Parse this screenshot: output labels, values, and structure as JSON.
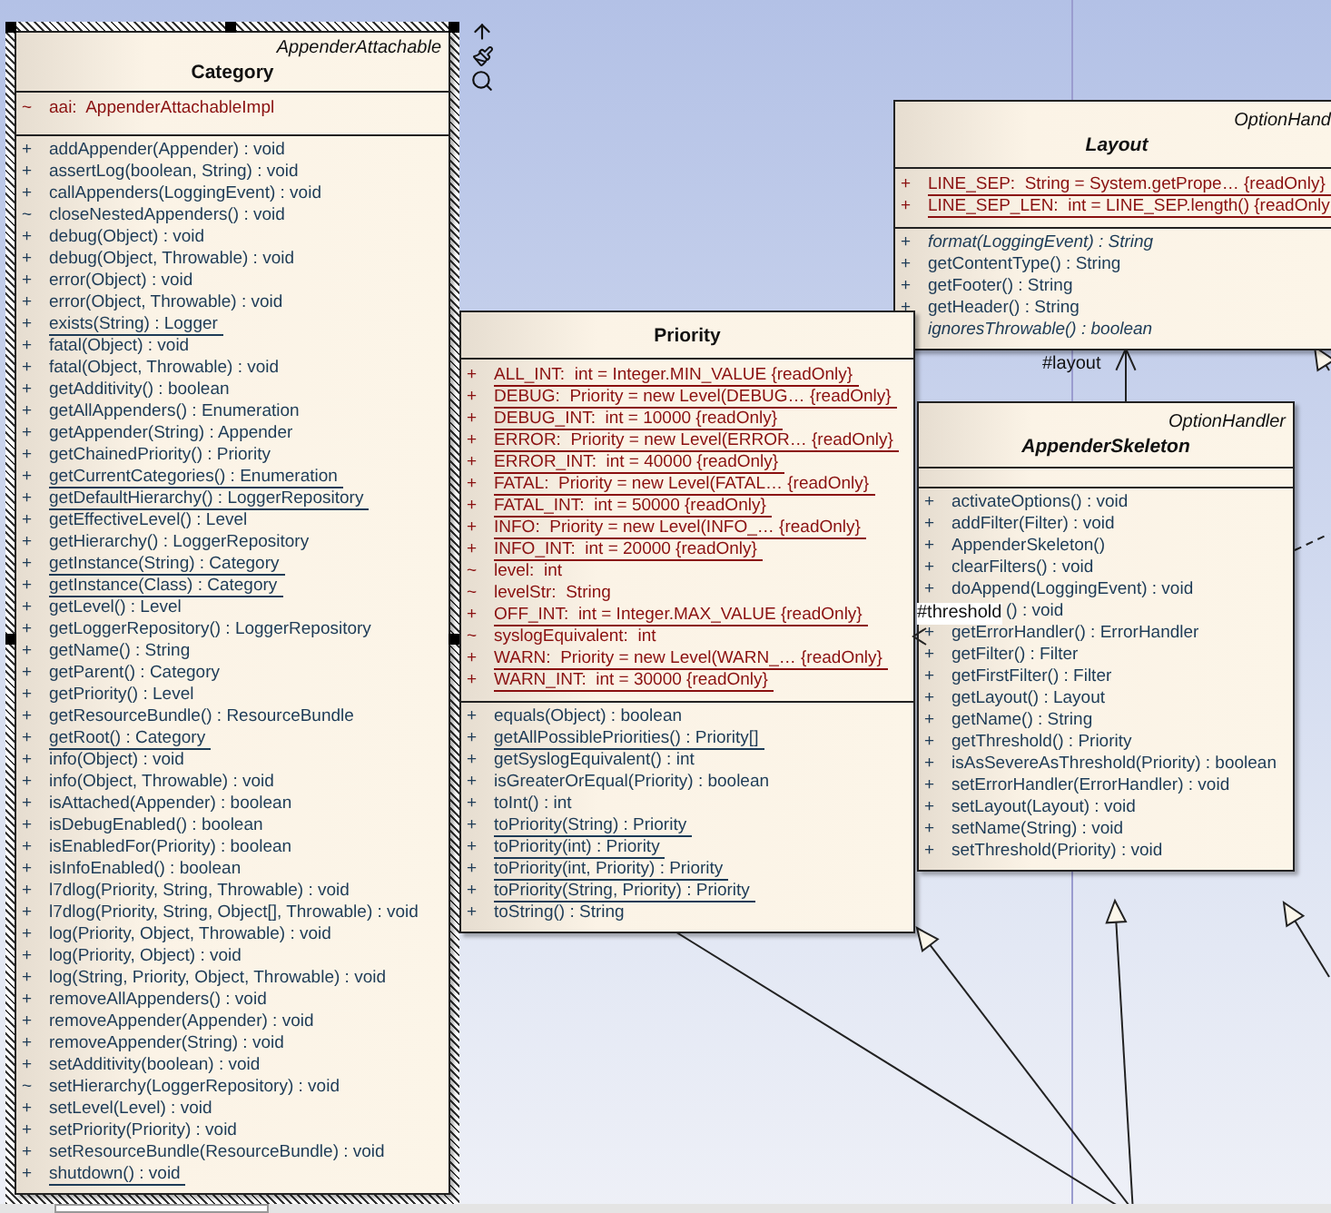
{
  "classes": [
    {
      "name": "Category",
      "stereotype": "AppenderAttachable",
      "abstract": false,
      "selected": true,
      "attributes": [
        {
          "visibility": "~",
          "text": "aai:  AppenderAttachableImpl",
          "static": false
        }
      ],
      "operations": [
        {
          "visibility": "+",
          "text": "addAppender(Appender) : void",
          "static": false
        },
        {
          "visibility": "+",
          "text": "assertLog(boolean, String) : void",
          "static": false
        },
        {
          "visibility": "+",
          "text": "callAppenders(LoggingEvent) : void",
          "static": false
        },
        {
          "visibility": "~",
          "text": "closeNestedAppenders() : void",
          "static": false
        },
        {
          "visibility": "+",
          "text": "debug(Object) : void",
          "static": false
        },
        {
          "visibility": "+",
          "text": "debug(Object, Throwable) : void",
          "static": false
        },
        {
          "visibility": "+",
          "text": "error(Object) : void",
          "static": false
        },
        {
          "visibility": "+",
          "text": "error(Object, Throwable) : void",
          "static": false
        },
        {
          "visibility": "+",
          "text": "exists(String) : Logger",
          "static": true
        },
        {
          "visibility": "+",
          "text": "fatal(Object) : void",
          "static": false
        },
        {
          "visibility": "+",
          "text": "fatal(Object, Throwable) : void",
          "static": false
        },
        {
          "visibility": "+",
          "text": "getAdditivity() : boolean",
          "static": false
        },
        {
          "visibility": "+",
          "text": "getAllAppenders() : Enumeration",
          "static": false
        },
        {
          "visibility": "+",
          "text": "getAppender(String) : Appender",
          "static": false
        },
        {
          "visibility": "+",
          "text": "getChainedPriority() : Priority",
          "static": false
        },
        {
          "visibility": "+",
          "text": "getCurrentCategories() : Enumeration",
          "static": true
        },
        {
          "visibility": "+",
          "text": "getDefaultHierarchy() : LoggerRepository",
          "static": true
        },
        {
          "visibility": "+",
          "text": "getEffectiveLevel() : Level",
          "static": false
        },
        {
          "visibility": "+",
          "text": "getHierarchy() : LoggerRepository",
          "static": false
        },
        {
          "visibility": "+",
          "text": "getInstance(String) : Category",
          "static": true
        },
        {
          "visibility": "+",
          "text": "getInstance(Class) : Category",
          "static": true
        },
        {
          "visibility": "+",
          "text": "getLevel() : Level",
          "static": false
        },
        {
          "visibility": "+",
          "text": "getLoggerRepository() : LoggerRepository",
          "static": false
        },
        {
          "visibility": "+",
          "text": "getName() : String",
          "static": false
        },
        {
          "visibility": "+",
          "text": "getParent() : Category",
          "static": false
        },
        {
          "visibility": "+",
          "text": "getPriority() : Level",
          "static": false
        },
        {
          "visibility": "+",
          "text": "getResourceBundle() : ResourceBundle",
          "static": false
        },
        {
          "visibility": "+",
          "text": "getRoot() : Category",
          "static": true
        },
        {
          "visibility": "+",
          "text": "info(Object) : void",
          "static": false
        },
        {
          "visibility": "+",
          "text": "info(Object, Throwable) : void",
          "static": false
        },
        {
          "visibility": "+",
          "text": "isAttached(Appender) : boolean",
          "static": false
        },
        {
          "visibility": "+",
          "text": "isDebugEnabled() : boolean",
          "static": false
        },
        {
          "visibility": "+",
          "text": "isEnabledFor(Priority) : boolean",
          "static": false
        },
        {
          "visibility": "+",
          "text": "isInfoEnabled() : boolean",
          "static": false
        },
        {
          "visibility": "+",
          "text": "l7dlog(Priority, String, Throwable) : void",
          "static": false
        },
        {
          "visibility": "+",
          "text": "l7dlog(Priority, String, Object[], Throwable) : void",
          "static": false
        },
        {
          "visibility": "+",
          "text": "log(Priority, Object, Throwable) : void",
          "static": false
        },
        {
          "visibility": "+",
          "text": "log(Priority, Object) : void",
          "static": false
        },
        {
          "visibility": "+",
          "text": "log(String, Priority, Object, Throwable) : void",
          "static": false
        },
        {
          "visibility": "+",
          "text": "removeAllAppenders() : void",
          "static": false
        },
        {
          "visibility": "+",
          "text": "removeAppender(Appender) : void",
          "static": false
        },
        {
          "visibility": "+",
          "text": "removeAppender(String) : void",
          "static": false
        },
        {
          "visibility": "+",
          "text": "setAdditivity(boolean) : void",
          "static": false
        },
        {
          "visibility": "~",
          "text": "setHierarchy(LoggerRepository) : void",
          "static": false
        },
        {
          "visibility": "+",
          "text": "setLevel(Level) : void",
          "static": false
        },
        {
          "visibility": "+",
          "text": "setPriority(Priority) : void",
          "static": false
        },
        {
          "visibility": "+",
          "text": "setResourceBundle(ResourceBundle) : void",
          "static": false
        },
        {
          "visibility": "+",
          "text": "shutdown() : void",
          "static": true
        }
      ]
    },
    {
      "name": "Layout",
      "stereotype": "OptionHand",
      "abstract": true,
      "selected": false,
      "attributes": [
        {
          "visibility": "+",
          "text": "LINE_SEP:  String = System.getPrope… {readOnly}",
          "static": true
        },
        {
          "visibility": "+",
          "text": "LINE_SEP_LEN:  int = LINE_SEP.length() {readOnly",
          "static": true
        }
      ],
      "operations": [
        {
          "visibility": "+",
          "text": "format(LoggingEvent) : String",
          "static": false,
          "abstract": true
        },
        {
          "visibility": "+",
          "text": "getContentType() : String",
          "static": false,
          "abstract": false
        },
        {
          "visibility": "+",
          "text": "getFooter() : String",
          "static": false,
          "abstract": false
        },
        {
          "visibility": "+",
          "text": "getHeader() : String",
          "static": false,
          "abstract": false
        },
        {
          "text": "ignoresThrowable() : boolean",
          "static": false,
          "abstract": true
        }
      ]
    },
    {
      "name": "Priority",
      "abstract": false,
      "selected": false,
      "attributes": [
        {
          "visibility": "+",
          "text": "ALL_INT:  int = Integer.MIN_VALUE {readOnly}",
          "static": true
        },
        {
          "visibility": "+",
          "text": "DEBUG:  Priority = new Level(DEBUG… {readOnly}",
          "static": true
        },
        {
          "visibility": "+",
          "text": "DEBUG_INT:  int = 10000 {readOnly}",
          "static": true
        },
        {
          "visibility": "+",
          "text": "ERROR:  Priority = new Level(ERROR… {readOnly}",
          "static": true
        },
        {
          "visibility": "+",
          "text": "ERROR_INT:  int = 40000 {readOnly}",
          "static": true
        },
        {
          "visibility": "+",
          "text": "FATAL:  Priority = new Level(FATAL… {readOnly}",
          "static": true
        },
        {
          "visibility": "+",
          "text": "FATAL_INT:  int = 50000 {readOnly}",
          "static": true
        },
        {
          "visibility": "+",
          "text": "INFO:  Priority = new Level(INFO_… {readOnly}",
          "static": true
        },
        {
          "visibility": "+",
          "text": "INFO_INT:  int = 20000 {readOnly}",
          "static": true
        },
        {
          "visibility": "~",
          "text": "level:  int",
          "static": false
        },
        {
          "visibility": "~",
          "text": "levelStr:  String",
          "static": false
        },
        {
          "visibility": "+",
          "text": "OFF_INT:  int = Integer.MAX_VALUE {readOnly}",
          "static": true
        },
        {
          "visibility": "~",
          "text": "syslogEquivalent:  int",
          "static": false
        },
        {
          "visibility": "+",
          "text": "WARN:  Priority = new Level(WARN_… {readOnly}",
          "static": true
        },
        {
          "visibility": "+",
          "text": "WARN_INT:  int = 30000 {readOnly}",
          "static": true
        }
      ],
      "operations": [
        {
          "visibility": "+",
          "text": "equals(Object) : boolean",
          "static": false
        },
        {
          "visibility": "+",
          "text": "getAllPossiblePriorities() : Priority[]",
          "static": true
        },
        {
          "visibility": "+",
          "text": "getSyslogEquivalent() : int",
          "static": false
        },
        {
          "visibility": "+",
          "text": "isGreaterOrEqual(Priority) : boolean",
          "static": false
        },
        {
          "visibility": "+",
          "text": "toInt() : int",
          "static": false
        },
        {
          "visibility": "+",
          "text": "toPriority(String) : Priority",
          "static": true
        },
        {
          "visibility": "+",
          "text": "toPriority(int) : Priority",
          "static": true
        },
        {
          "visibility": "+",
          "text": "toPriority(int, Priority) : Priority",
          "static": true
        },
        {
          "visibility": "+",
          "text": "toPriority(String, Priority) : Priority",
          "static": true
        },
        {
          "visibility": "+",
          "text": "toString() : String",
          "static": false
        }
      ]
    },
    {
      "name": "AppenderSkeleton",
      "stereotype": "OptionHandler",
      "abstract": true,
      "selected": false,
      "operations": [
        {
          "visibility": "+",
          "text": "activateOptions() : void",
          "static": false
        },
        {
          "visibility": "+",
          "text": "addFilter(Filter) : void",
          "static": false
        },
        {
          "visibility": "+",
          "text": "AppenderSkeleton()",
          "static": false
        },
        {
          "visibility": "+",
          "text": "clearFilters() : void",
          "static": false
        },
        {
          "visibility": "+",
          "text": "doAppend(LoggingEvent) : void",
          "static": false
        },
        {
          "kind": "covered",
          "text": "() : void",
          "static": false
        },
        {
          "visibility": "+",
          "text": "getErrorHandler() : ErrorHandler",
          "static": false
        },
        {
          "visibility": "+",
          "text": "getFilter() : Filter",
          "static": false
        },
        {
          "visibility": "+",
          "text": "getFirstFilter() : Filter",
          "static": false
        },
        {
          "visibility": "+",
          "text": "getLayout() : Layout",
          "static": false
        },
        {
          "visibility": "+",
          "text": "getName() : String",
          "static": false
        },
        {
          "visibility": "+",
          "text": "getThreshold() : Priority",
          "static": false
        },
        {
          "visibility": "+",
          "text": "isAsSevereAsThreshold(Priority) : boolean",
          "static": false
        },
        {
          "visibility": "+",
          "text": "setErrorHandler(ErrorHandler) : void",
          "static": false
        },
        {
          "visibility": "+",
          "text": "setLayout(Layout) : void",
          "static": false
        },
        {
          "visibility": "+",
          "text": "setName(String) : void",
          "static": false
        },
        {
          "visibility": "+",
          "text": "setThreshold(Priority) : void",
          "static": false
        }
      ]
    }
  ],
  "connector_labels": [
    "#layout",
    "#threshold"
  ]
}
